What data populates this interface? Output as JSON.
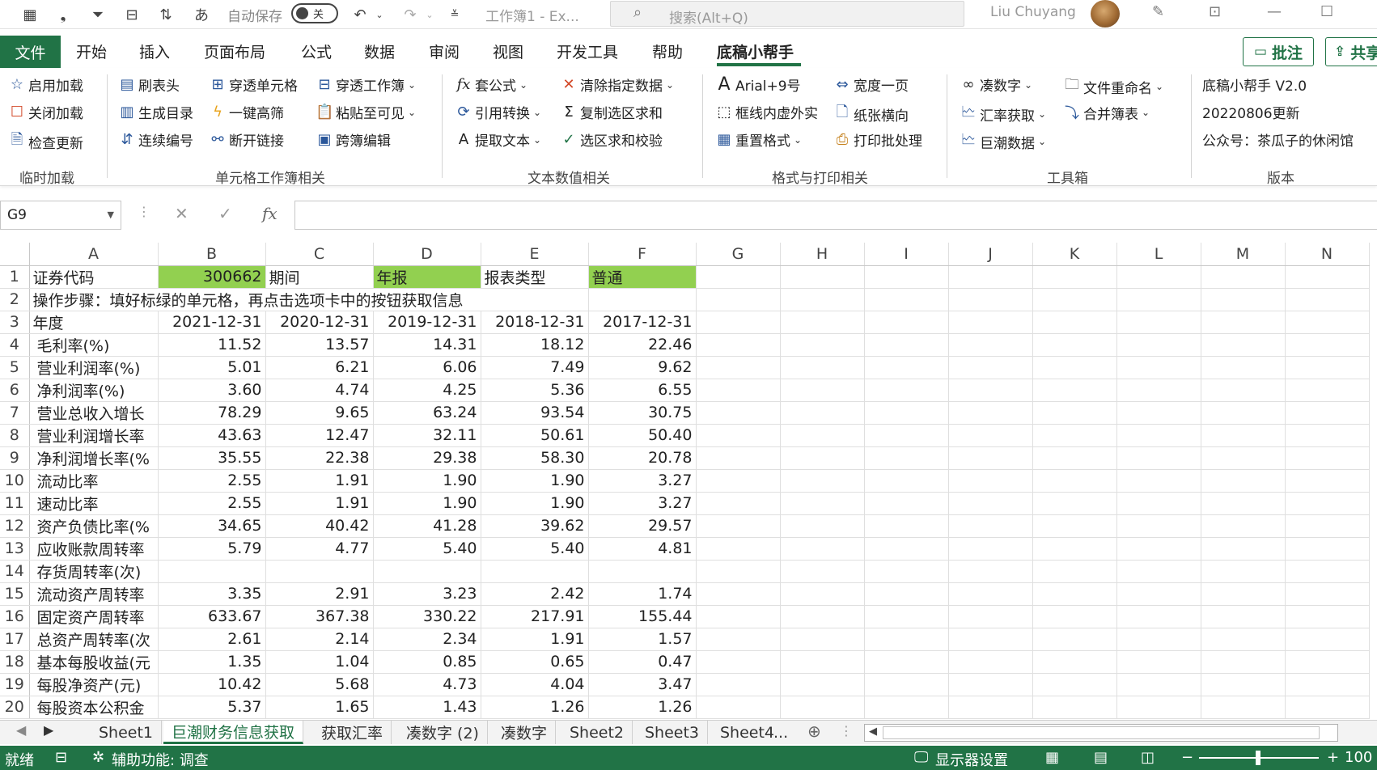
{
  "titlebar": {
    "autosave_label": "自动保存",
    "autosave_state": "关",
    "doc_title": "工作簿1  -  Ex...",
    "search_placeholder": "搜索(Alt+Q)",
    "user_name": "Liu Chuyang"
  },
  "tabs": {
    "file": "文件",
    "items": [
      "开始",
      "插入",
      "页面布局",
      "公式",
      "数据",
      "审阅",
      "视图",
      "开发工具",
      "帮助",
      "底稿小帮手"
    ],
    "active": "底稿小帮手",
    "comment": "批注",
    "share": "共享"
  },
  "ribbon": {
    "groups": {
      "temp_load": "临时加载",
      "cell_book": "单元格工作簿相关",
      "text_num": "文本数值相关",
      "format_print": "格式与打印相关",
      "toolbox": "工具箱",
      "version": "版本"
    },
    "buttons": {
      "enable_load": "启用加载",
      "close_load": "关闭加载",
      "check_update": "检查更新",
      "refresh_header": "刷表头",
      "gen_toc": "生成目录",
      "serial_no": "连续编号",
      "pierce_cell": "穿透单元格",
      "one_key_filter": "一键高筛",
      "break_link": "断开链接",
      "pierce_book": "穿透工作簿",
      "paste_visible": "粘贴至可见",
      "cross_edit": "跨簿编辑",
      "apply_formula": "套公式",
      "ref_convert": "引用转换",
      "extract_text": "提取文本",
      "clear_data": "清除指定数据",
      "copy_sum": "复制选区求和",
      "sum_check": "选区求和校验",
      "arial": "Arial+9号",
      "border_style": "框线内虚外实",
      "reset_format": "重置格式",
      "width_page": "宽度一页",
      "landscape": "纸张横向",
      "batch_print": "打印批处理",
      "round_num": "凑数字",
      "fx_rate": "汇率获取",
      "cninfo": "巨潮数据",
      "rename_file": "文件重命名",
      "merge_sheets": "合并簿表"
    },
    "version_lines": [
      "底稿小帮手 V2.0",
      "20220806更新",
      "公众号：茶瓜子的休闲馆"
    ]
  },
  "formula_bar": {
    "namebox": "G9",
    "formula": ""
  },
  "sheet": {
    "columns": [
      "A",
      "B",
      "C",
      "D",
      "E",
      "F",
      "G",
      "H",
      "I",
      "J",
      "K",
      "L",
      "M",
      "N"
    ],
    "row1": {
      "a": "证券代码",
      "b": "300662",
      "c": "期间",
      "d": "年报",
      "e": "报表类型",
      "f": "普通"
    },
    "row2": {
      "a": "操作步骤：填好标绿的单元格，再点击选项卡中的按钮获取信息"
    },
    "row3": {
      "a": "年度",
      "years": [
        "2021-12-31",
        "2020-12-31",
        "2019-12-31",
        "2018-12-31",
        "2017-12-31"
      ]
    },
    "rows": [
      {
        "n": "4",
        "label": "毛利率(%)",
        "v": [
          "11.52",
          "13.57",
          "14.31",
          "18.12",
          "22.46"
        ]
      },
      {
        "n": "5",
        "label": "营业利润率(%)",
        "v": [
          "5.01",
          "6.21",
          "6.06",
          "7.49",
          "9.62"
        ]
      },
      {
        "n": "6",
        "label": "净利润率(%)",
        "v": [
          "3.60",
          "4.74",
          "4.25",
          "5.36",
          "6.55"
        ]
      },
      {
        "n": "7",
        "label": "营业总收入增长",
        "v": [
          "78.29",
          "9.65",
          "63.24",
          "93.54",
          "30.75"
        ]
      },
      {
        "n": "8",
        "label": "营业利润增长率",
        "v": [
          "43.63",
          "12.47",
          "32.11",
          "50.61",
          "50.40"
        ]
      },
      {
        "n": "9",
        "label": "净利润增长率(%",
        "v": [
          "35.55",
          "22.38",
          "29.38",
          "58.30",
          "20.78"
        ]
      },
      {
        "n": "10",
        "label": "流动比率",
        "v": [
          "2.55",
          "1.91",
          "1.90",
          "1.90",
          "3.27"
        ]
      },
      {
        "n": "11",
        "label": "速动比率",
        "v": [
          "2.55",
          "1.91",
          "1.90",
          "1.90",
          "3.27"
        ]
      },
      {
        "n": "12",
        "label": "资产负债比率(%",
        "v": [
          "34.65",
          "40.42",
          "41.28",
          "39.62",
          "29.57"
        ]
      },
      {
        "n": "13",
        "label": "应收账款周转率",
        "v": [
          "5.79",
          "4.77",
          "5.40",
          "5.40",
          "4.81"
        ]
      },
      {
        "n": "14",
        "label": "存货周转率(次)",
        "v": [
          "",
          "",
          "",
          "",
          ""
        ]
      },
      {
        "n": "15",
        "label": "流动资产周转率",
        "v": [
          "3.35",
          "2.91",
          "3.23",
          "2.42",
          "1.74"
        ]
      },
      {
        "n": "16",
        "label": "固定资产周转率",
        "v": [
          "633.67",
          "367.38",
          "330.22",
          "217.91",
          "155.44"
        ]
      },
      {
        "n": "17",
        "label": "总资产周转率(次",
        "v": [
          "2.61",
          "2.14",
          "2.34",
          "1.91",
          "1.57"
        ]
      },
      {
        "n": "18",
        "label": "基本每股收益(元",
        "v": [
          "1.35",
          "1.04",
          "0.85",
          "0.65",
          "0.47"
        ]
      },
      {
        "n": "19",
        "label": "每股净资产(元)",
        "v": [
          "10.42",
          "5.68",
          "4.73",
          "4.04",
          "3.47"
        ]
      },
      {
        "n": "20",
        "label": "每股资本公积金",
        "v": [
          "5.37",
          "1.65",
          "1.43",
          "1.26",
          "1.26"
        ]
      }
    ]
  },
  "sheet_tabs": {
    "items": [
      "Sheet1",
      "巨潮财务信息获取",
      "获取汇率",
      "凑数字 (2)",
      "凑数字",
      "Sheet2",
      "Sheet3",
      "Sheet4"
    ],
    "active": "巨潮财务信息获取",
    "more": "..."
  },
  "statusbar": {
    "ready": "就绪",
    "accessibility": "辅助功能: 调查",
    "display_settings": "显示器设置",
    "zoom": "100"
  },
  "colors": {
    "accent": "#217346",
    "input_fill": "#92d050"
  }
}
